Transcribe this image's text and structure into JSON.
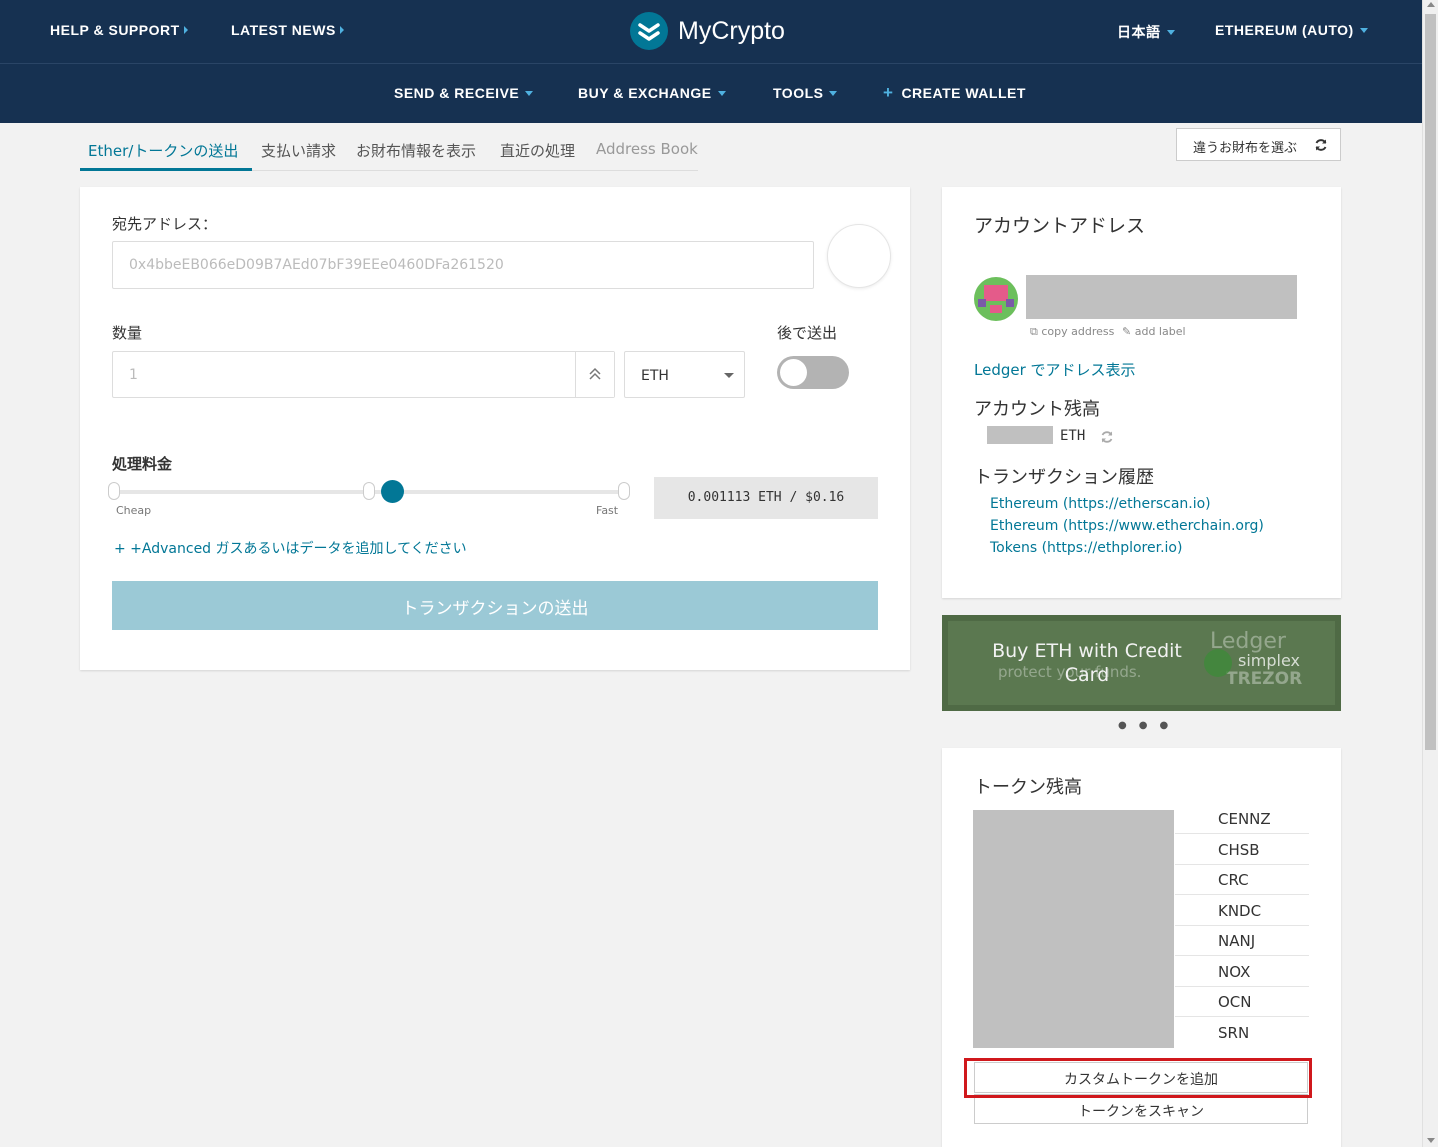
{
  "header": {
    "help_support": "HELP & SUPPORT",
    "latest_news": "LATEST NEWS",
    "brand": "MyCrypto",
    "language": "日本語",
    "network": "ETHEREUM (AUTO)"
  },
  "nav": {
    "send_receive": "SEND & RECEIVE",
    "buy_exchange": "BUY & EXCHANGE",
    "tools": "TOOLS",
    "create_wallet": "CREATE WALLET"
  },
  "tabs": [
    "Ether/トークンの送出",
    "支払い請求",
    "お財布情報を表示",
    "直近の処理",
    "Address Book"
  ],
  "change_wallet": "違うお財布を選ぶ",
  "send_form": {
    "to_address_label": "宛先アドレス：",
    "to_address_placeholder": "0x4bbeEB066eD09B7AEd07bF39EEe0460DFa261520",
    "amount_label": "数量",
    "amount_placeholder": "1",
    "unit": "ETH",
    "send_later_label": "後で送出",
    "fee_label": "処理料金",
    "cheap": "Cheap",
    "fast": "Fast",
    "fee_value": "0.001113 ETH / $0.16",
    "advanced": "+ +Advanced ガスあるいはデータを追加してください",
    "send_button": "トランザクションの送出"
  },
  "account": {
    "title": "アカウントアドレス",
    "copy_address": "copy address",
    "add_label": "add label",
    "ledger_link": "Ledger でアドレス表示",
    "balance_title": "アカウント残高",
    "balance_unit": "ETH",
    "history_title": "トランザクション履歴",
    "history_links": [
      "Ethereum (https://etherscan.io)",
      "Ethereum (https://www.etherchain.org)",
      "Tokens (https://ethplorer.io)"
    ]
  },
  "ad": {
    "headline": "Buy ETH with Credit Card",
    "subtext": "protect your funds.",
    "brands": [
      "Ledger",
      "simplex",
      "TREZOR"
    ]
  },
  "tokens": {
    "title": "トークン残高",
    "symbols": [
      "CENNZ",
      "CHSB",
      "CRC",
      "KNDC",
      "NANJ",
      "NOX",
      "OCN",
      "SRN"
    ],
    "add_custom": "カスタムトークンを追加",
    "scan": "トークンをスキャン"
  },
  "colors": {
    "header_bg": "#163151",
    "accent": "#027796",
    "highlight_border": "#d0181c"
  }
}
